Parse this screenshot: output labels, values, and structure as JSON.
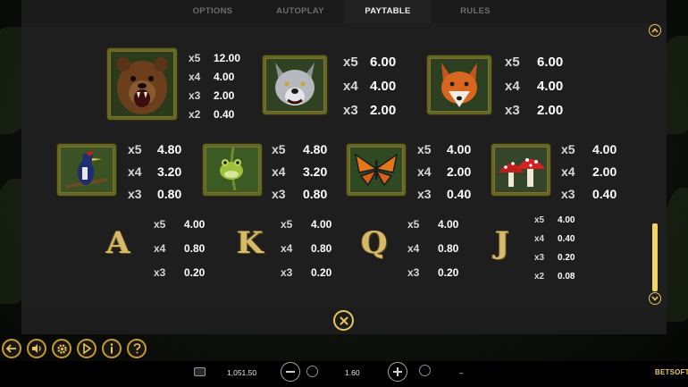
{
  "tabs": [
    {
      "label": "OPTIONS"
    },
    {
      "label": "AUTOPLAY"
    },
    {
      "label": "PAYTABLE"
    },
    {
      "label": "RULES"
    }
  ],
  "active_tab": "PAYTABLE",
  "symbols": {
    "bear": {
      "icon": "bear-icon",
      "pays": [
        {
          "m": "x5",
          "v": "12.00"
        },
        {
          "m": "x4",
          "v": "4.00"
        },
        {
          "m": "x3",
          "v": "2.00"
        },
        {
          "m": "x2",
          "v": "0.40"
        }
      ]
    },
    "wolf": {
      "icon": "wolf-icon",
      "pays": [
        {
          "m": "x5",
          "v": "6.00"
        },
        {
          "m": "x4",
          "v": "4.00"
        },
        {
          "m": "x3",
          "v": "2.00"
        }
      ]
    },
    "fox": {
      "icon": "fox-icon",
      "pays": [
        {
          "m": "x5",
          "v": "6.00"
        },
        {
          "m": "x4",
          "v": "4.00"
        },
        {
          "m": "x3",
          "v": "2.00"
        }
      ]
    },
    "woodpecker": {
      "icon": "woodpecker-icon",
      "pays": [
        {
          "m": "x5",
          "v": "4.80"
        },
        {
          "m": "x4",
          "v": "3.20"
        },
        {
          "m": "x3",
          "v": "0.80"
        }
      ]
    },
    "frog": {
      "icon": "frog-icon",
      "pays": [
        {
          "m": "x5",
          "v": "4.80"
        },
        {
          "m": "x4",
          "v": "3.20"
        },
        {
          "m": "x3",
          "v": "0.80"
        }
      ]
    },
    "butterfly": {
      "icon": "butterfly-icon",
      "pays": [
        {
          "m": "x5",
          "v": "4.00"
        },
        {
          "m": "x4",
          "v": "2.00"
        },
        {
          "m": "x3",
          "v": "0.40"
        }
      ]
    },
    "mushroom": {
      "icon": "mushroom-icon",
      "pays": [
        {
          "m": "x5",
          "v": "4.00"
        },
        {
          "m": "x4",
          "v": "2.00"
        },
        {
          "m": "x3",
          "v": "0.40"
        }
      ]
    },
    "a": {
      "letter": "A",
      "pays": [
        {
          "m": "x5",
          "v": "4.00"
        },
        {
          "m": "x4",
          "v": "0.80"
        },
        {
          "m": "x3",
          "v": "0.20"
        }
      ]
    },
    "k": {
      "letter": "K",
      "pays": [
        {
          "m": "x5",
          "v": "4.00"
        },
        {
          "m": "x4",
          "v": "0.80"
        },
        {
          "m": "x3",
          "v": "0.20"
        }
      ]
    },
    "q": {
      "letter": "Q",
      "pays": [
        {
          "m": "x5",
          "v": "4.00"
        },
        {
          "m": "x4",
          "v": "0.80"
        },
        {
          "m": "x3",
          "v": "0.20"
        }
      ]
    },
    "j": {
      "letter": "J",
      "pays": [
        {
          "m": "x5",
          "v": "4.00"
        },
        {
          "m": "x4",
          "v": "0.40"
        },
        {
          "m": "x3",
          "v": "0.20"
        },
        {
          "m": "x2",
          "v": "0.08"
        }
      ]
    }
  },
  "controls": [
    "back-icon",
    "sound-icon",
    "settings-icon",
    "play-icon",
    "info-icon",
    "help-icon"
  ],
  "footer": {
    "balance": "1,051.50",
    "bet": "1.60",
    "win": "–",
    "brand": "BETSOFT"
  },
  "colors": {
    "accent_gold": "#e8c75a",
    "panel": "#1e1e1f",
    "frame_green": "#5e6a22"
  }
}
